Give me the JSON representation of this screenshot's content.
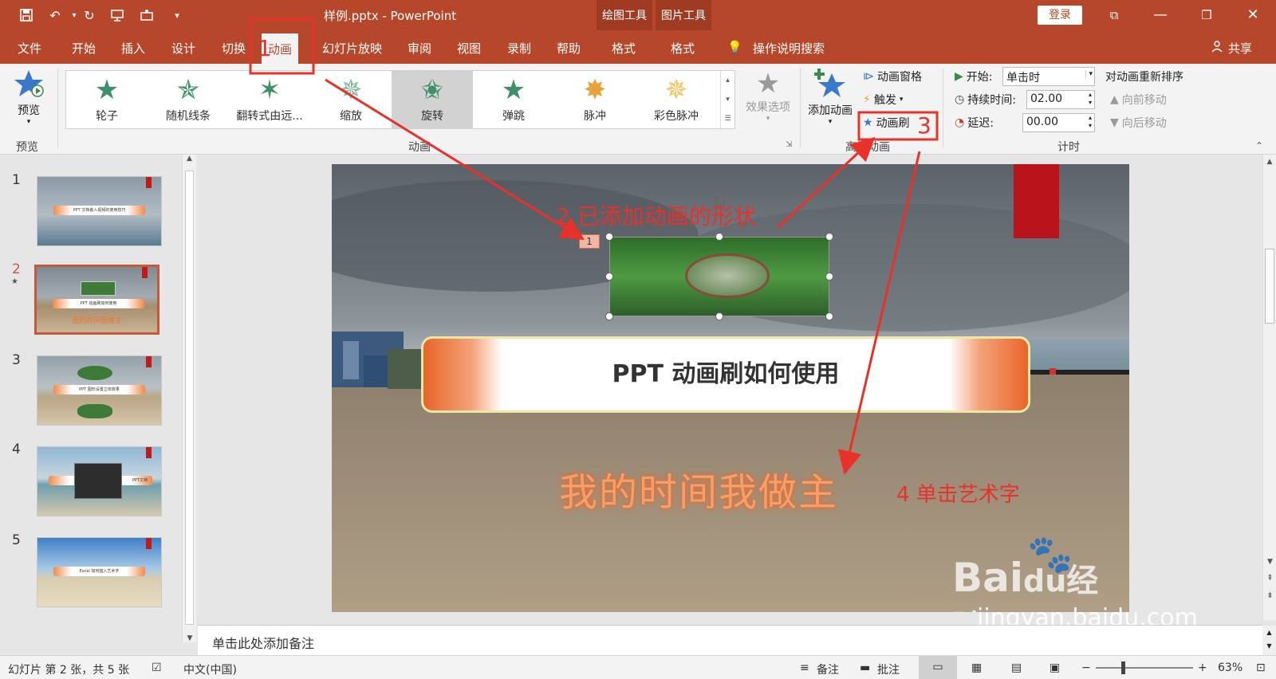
{
  "titlebar": {
    "title": "样例.pptx  -  PowerPoint",
    "context_draw": "绘图工具",
    "context_picture": "图片工具",
    "login": "登录"
  },
  "tabs": [
    "文件",
    "开始",
    "插入",
    "设计",
    "切换",
    "动画",
    "幻灯片放映",
    "审阅",
    "视图",
    "录制",
    "帮助",
    "格式",
    "格式"
  ],
  "tellme": "操作说明搜索",
  "share": "共享",
  "ribbon": {
    "preview": "预览",
    "preview_group": "预览",
    "gallery": [
      "轮子",
      "随机线条",
      "翻转式由远...",
      "缩放",
      "旋转",
      "弹跳",
      "脉冲",
      "彩色脉冲"
    ],
    "effect_options": "效果选项",
    "animation_group": "动画",
    "add_animation": "添加动画",
    "animation_pane": "动画窗格",
    "trigger": "触发",
    "animation_painter": "动画刷",
    "advanced_group": "高级动画",
    "start_label": "开始:",
    "start_value": "单击时",
    "duration_label": "持续时间:",
    "duration_value": "02.00",
    "delay_label": "延迟:",
    "delay_value": "00.00",
    "reorder_title": "对动画重新排序",
    "move_earlier": "向前移动",
    "move_later": "向后移动",
    "timing_group": "计时"
  },
  "thumbnails": [
    "1",
    "2",
    "3",
    "4",
    "5"
  ],
  "thumb_texts": {
    "t1": "PPT 文档嵌入视频的使用技巧",
    "t2": "PPT 动画刷如何使用",
    "t2b": "我的时间我做主",
    "t3": "PPT 图形设置立体效果",
    "t5": "Excel 如何插入艺术字",
    "t4": "PPT文档"
  },
  "slide": {
    "anim_number": "1",
    "banner_text": "PPT 动画刷如何使用",
    "wordart": "我的时间我做主"
  },
  "annotations": {
    "a1": "1",
    "a2": "2 已添加动画的形状",
    "a3": "3",
    "a4": "4 单击艺术字"
  },
  "notes_placeholder": "单击此处添加备注",
  "status": {
    "slide_info": "幻灯片 第 2 张，共 5 张",
    "language": "中文(中国)",
    "notes": "备注",
    "comments": "批注",
    "zoom": "63%"
  },
  "watermark": {
    "brand": "Bai",
    "du": "du",
    "suffix": "经验",
    "url": "jingyan.baidu.com"
  },
  "colors": {
    "accent": "#b7472a",
    "annotation": "#e8312a",
    "green_star": "#3f8f6a"
  }
}
